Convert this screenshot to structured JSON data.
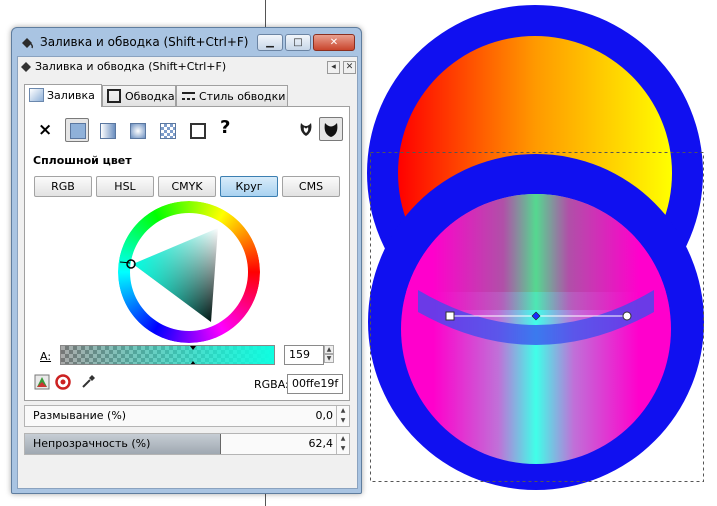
{
  "window": {
    "title": "Заливка и обводка (Shift+Ctrl+F)",
    "dock_title": "Заливка и обводка (Shift+Ctrl+F)",
    "controls": {
      "minimize": "▁",
      "maximize": "□",
      "close": "✕"
    }
  },
  "tabs": [
    {
      "label": "Заливка",
      "active": true
    },
    {
      "label": "Обводка",
      "active": false
    },
    {
      "label": "Стиль обводки",
      "active": false
    }
  ],
  "paint_types": {
    "none": "×",
    "unknown": "?",
    "selected": "flat-color"
  },
  "section_label": "Сплошной цвет",
  "color_modes": [
    {
      "label": "RGB",
      "active": false
    },
    {
      "label": "HSL",
      "active": false
    },
    {
      "label": "CMYK",
      "active": false
    },
    {
      "label": "Круг",
      "active": true
    },
    {
      "label": "CMS",
      "active": false
    }
  ],
  "alpha": {
    "label": "A:",
    "value": "159",
    "fraction": 0.62
  },
  "rgba": {
    "label": "RGBA:",
    "value": "00ffe19f"
  },
  "blur": {
    "label": "Размывание (%)",
    "value": "0,0"
  },
  "opacity": {
    "label": "Непрозрачность (%)",
    "value": "62,4",
    "fraction": 0.624
  },
  "colors": {
    "fill": "#00ffe1",
    "stroke": "#0000ff",
    "accent": "#3c7fb1"
  }
}
